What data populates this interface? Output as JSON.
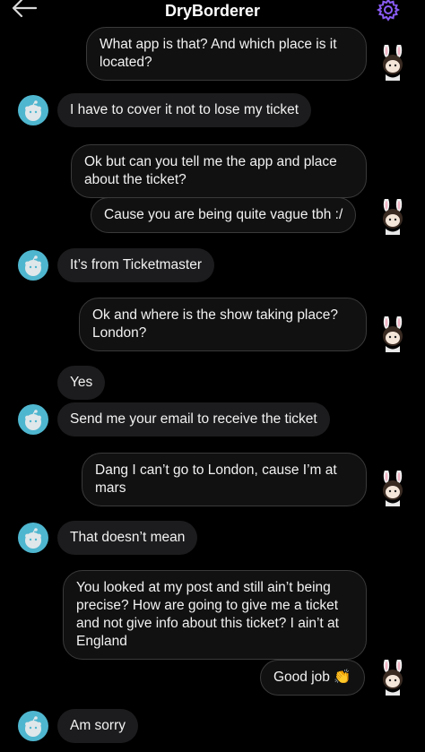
{
  "header": {
    "title": "DryBorderer",
    "icons": {
      "back": "arrow-left-icon",
      "settings": "gear-icon"
    },
    "accent_color": "#8a5cf5"
  },
  "messages": [
    {
      "side": "out",
      "text": "What app is that? And which place is it located?"
    },
    {
      "side": "in",
      "text": "I have to cover it not to lose my ticket"
    },
    {
      "side": "out",
      "text": "Ok but can you tell me the app and place about the ticket?"
    },
    {
      "side": "out",
      "text": "Cause you are being quite vague tbh :/"
    },
    {
      "side": "in",
      "text": "It’s from Ticketmaster"
    },
    {
      "side": "out",
      "text": "Ok and where is the show taking place? London?"
    },
    {
      "side": "in",
      "text": "Yes"
    },
    {
      "side": "in",
      "text": "Send me your email to receive the ticket"
    },
    {
      "side": "out",
      "text": "Dang I can’t go to London, cause I’m at mars"
    },
    {
      "side": "in",
      "text": "That doesn’t mean"
    },
    {
      "side": "out",
      "text": "You looked at my post and still ain’t being precise? How are going to give me a ticket and not give info about this ticket? I ain’t at England"
    },
    {
      "side": "out",
      "text": "Good job 👏"
    },
    {
      "side": "in",
      "text": "Am sorry"
    }
  ]
}
